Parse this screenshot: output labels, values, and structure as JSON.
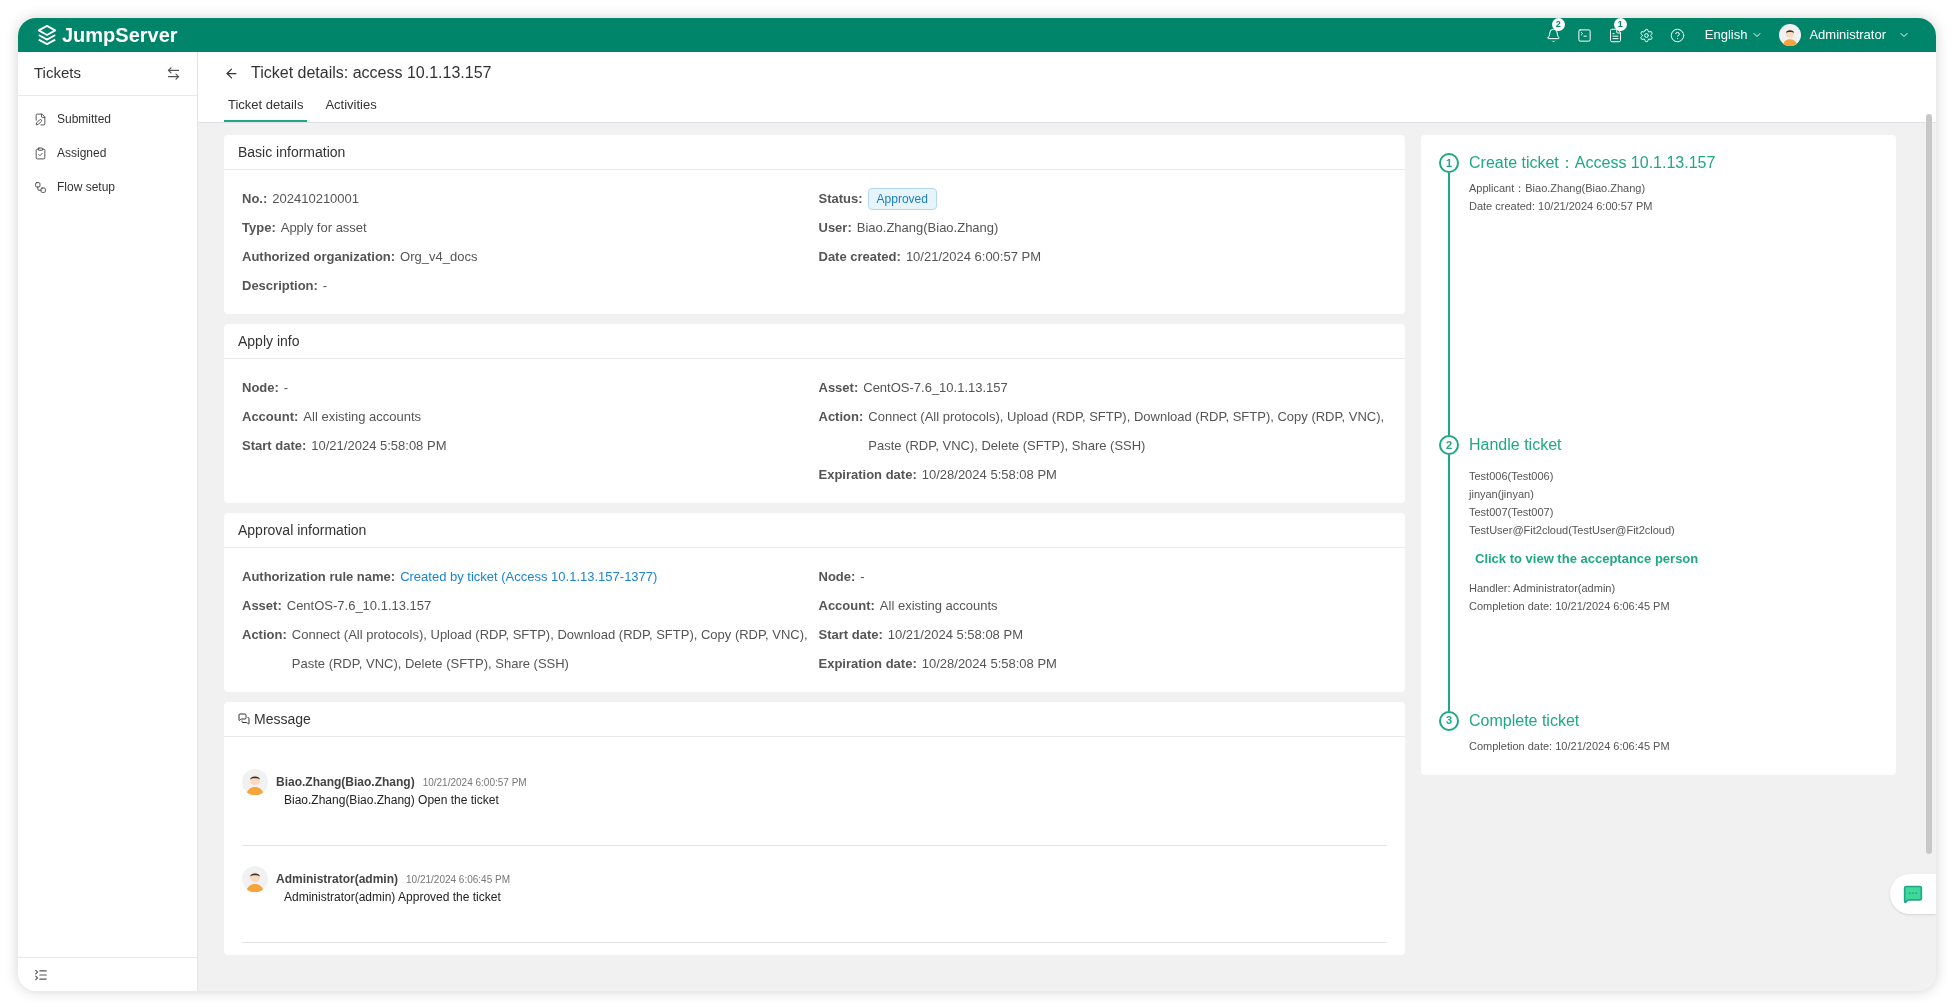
{
  "header": {
    "logo": "JumpServer",
    "notifications": [
      {
        "kind": "bell",
        "count": "2"
      },
      {
        "kind": "terminal"
      },
      {
        "kind": "list",
        "count": "1"
      },
      {
        "kind": "settings"
      },
      {
        "kind": "help"
      }
    ],
    "language": "English",
    "user": "Administrator"
  },
  "sidebar": {
    "title": "Tickets",
    "items": [
      {
        "kind": "submitted",
        "label": "Submitted",
        "selected": false
      },
      {
        "kind": "assigned",
        "label": "Assigned",
        "selected": false
      },
      {
        "kind": "flow",
        "label": "Flow setup",
        "selected": false
      }
    ]
  },
  "page": {
    "title": "Ticket details: access 10.1.13.157",
    "tabs": [
      {
        "label": "Ticket details",
        "selected": true
      },
      {
        "label": "Activities",
        "selected": false
      }
    ]
  },
  "cards": [
    {
      "title": "Basic information",
      "left": [
        {
          "label": "No.:",
          "text": "202410210001",
          "kind": "text"
        },
        {
          "label": "Type:",
          "text": "Apply for asset",
          "kind": "text"
        },
        {
          "label": "Authorized organization:",
          "text": "Org_v4_docs",
          "kind": "text"
        },
        {
          "label": "Description:",
          "text": "-",
          "kind": "text"
        }
      ],
      "right": [
        {
          "label": "Status:",
          "text": "Approved",
          "kind": "badge"
        },
        {
          "label": "User:",
          "text": "Biao.Zhang(Biao.Zhang)",
          "kind": "text"
        },
        {
          "label": "Date created:",
          "text": "10/21/2024 6:00:57 PM",
          "kind": "text"
        }
      ]
    },
    {
      "title": "Apply info",
      "left": [
        {
          "label": "Node:",
          "text": "-",
          "kind": "text"
        },
        {
          "label": "Account:",
          "text": "All existing accounts",
          "kind": "text"
        },
        {
          "label": "Start date:",
          "text": "10/21/2024 5:58:08 PM",
          "kind": "text"
        }
      ],
      "right": [
        {
          "label": "Asset:",
          "text": "CentOS-7.6_10.1.13.157",
          "kind": "text"
        },
        {
          "label": "Action:",
          "text": "Connect (All protocols), Upload (RDP, SFTP), Download (RDP, SFTP), Copy (RDP, VNC), Paste (RDP, VNC), Delete (SFTP), Share (SSH)",
          "kind": "text"
        },
        {
          "label": "Expiration date:",
          "text": "10/28/2024 5:58:08 PM",
          "kind": "text"
        }
      ]
    },
    {
      "title": "Approval information",
      "left": [
        {
          "label": "Authorization rule name:",
          "text": "Created by ticket (Access 10.1.13.157-1377)",
          "kind": "link"
        },
        {
          "label": "Asset:",
          "text": "CentOS-7.6_10.1.13.157",
          "kind": "text"
        },
        {
          "label": "Action:",
          "text": "Connect (All protocols), Upload (RDP, SFTP), Download (RDP, SFTP), Copy (RDP, VNC), Paste (RDP, VNC), Delete (SFTP), Share (SSH)",
          "kind": "text"
        }
      ],
      "right": [
        {
          "label": "Node:",
          "text": "-",
          "kind": "text"
        },
        {
          "label": "Account:",
          "text": "All existing accounts",
          "kind": "text"
        },
        {
          "label": "Start date:",
          "text": "10/21/2024 5:58:08 PM",
          "kind": "text"
        },
        {
          "label": "Expiration date:",
          "text": "10/28/2024 5:58:08 PM",
          "kind": "text"
        }
      ]
    }
  ],
  "messages": {
    "title": "Message",
    "items": [
      {
        "author": "Biao.Zhang(Biao.Zhang)",
        "time": "10/21/2024 6:00:57 PM",
        "text": "Biao.Zhang(Biao.Zhang) Open the ticket"
      },
      {
        "author": "Administrator(admin)",
        "time": "10/21/2024 6:06:45 PM",
        "text": "Administrator(admin) Approved the ticket"
      }
    ]
  },
  "timeline": [
    {
      "number": "1",
      "title": "Create ticket：Access 10.1.13.157",
      "lines": [
        {
          "kind": "text",
          "text": "Applicant：Biao.Zhang(Biao.Zhang)"
        },
        {
          "kind": "text",
          "text": "Date created: 10/21/2024 6:00:57 PM"
        }
      ]
    },
    {
      "number": "2",
      "title": "Handle ticket",
      "lines": [
        {
          "kind": "text",
          "text": "Test006(Test006)"
        },
        {
          "kind": "text",
          "text": "jinyan(jinyan)"
        },
        {
          "kind": "text",
          "text": "Test007(Test007)"
        },
        {
          "kind": "text",
          "text": "TestUser@Fit2cloud(TestUser@Fit2cloud)"
        },
        {
          "kind": "link",
          "text": "Click to view the acceptance person"
        },
        {
          "kind": "text",
          "text": "Handler: Administrator(admin)"
        },
        {
          "kind": "text",
          "text": "Completion date: 10/21/2024 6:06:45 PM"
        }
      ]
    },
    {
      "number": "3",
      "title": "Complete ticket",
      "lines": [
        {
          "kind": "text",
          "text": "Completion date: 10/21/2024 6:06:45 PM"
        }
      ]
    }
  ]
}
